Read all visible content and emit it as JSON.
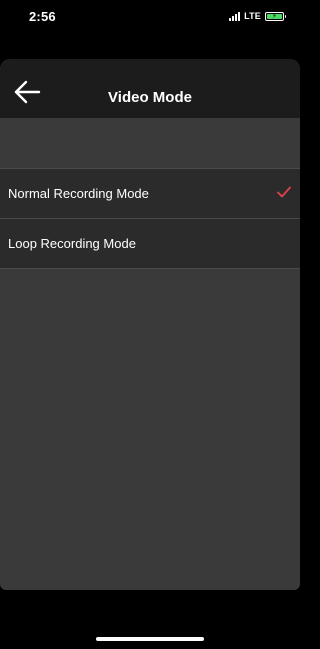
{
  "status_bar": {
    "time": "2:56",
    "network": "LTE",
    "battery_color": "#4cd964"
  },
  "nav": {
    "title": "Video Mode",
    "back_icon": "arrow-left-icon"
  },
  "options": [
    {
      "label": "Normal Recording Mode",
      "selected": true
    },
    {
      "label": "Loop Recording Mode",
      "selected": false
    }
  ],
  "colors": {
    "check": "#e0424a",
    "header_bg": "#1c1c1c",
    "row_bg": "#2b2b2b",
    "panel_bg": "#3a3a3a"
  }
}
